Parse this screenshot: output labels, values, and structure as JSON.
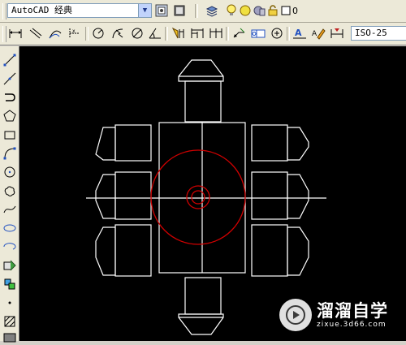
{
  "workspace_combo": {
    "value": "AutoCAD 经典"
  },
  "layer_combo": {
    "value": "0"
  },
  "dimstyle_combo": {
    "value": "ISO-25"
  },
  "watermark": {
    "title": "溜溜自学",
    "subtitle": "zixue.3d66.com"
  },
  "colors": {
    "canvas": "#000000",
    "geometry_white": "#ffffff",
    "geometry_red": "#d00000",
    "toolbar": "#ece9d8"
  },
  "toolbar_top": {
    "items": [
      "workspace-settings-icon",
      "workspace-toolbar-icon",
      "layer-manager-icon",
      "lightbulb-on-icon",
      "sun-thaw-icon",
      "layer-lock-icon",
      "layer-color-icon"
    ]
  },
  "toolbar_dimension": {
    "items": [
      "linear-dimension-icon",
      "aligned-dimension-icon",
      "arc-length-icon",
      "ordinate-dimension-icon",
      "radius-dimension-icon",
      "jogged-radius-icon",
      "diameter-dimension-icon",
      "angular-dimension-icon",
      "quick-dimension-icon",
      "baseline-dimension-icon",
      "continue-dimension-icon",
      "quick-leader-icon",
      "tolerance-icon",
      "center-mark-icon",
      "dimension-edit-icon",
      "dimension-text-edit-icon",
      "dimension-update-icon"
    ]
  },
  "toolbar_draw": {
    "items": [
      "line-icon",
      "construction-line-icon",
      "polyline-icon",
      "polygon-icon",
      "rectangle-icon",
      "arc-icon",
      "circle-icon",
      "revision-cloud-icon",
      "spline-icon",
      "ellipse-icon",
      "ellipse-arc-icon",
      "insert-block-icon",
      "make-block-icon",
      "point-icon",
      "hatch-icon",
      "gradient-icon"
    ]
  }
}
